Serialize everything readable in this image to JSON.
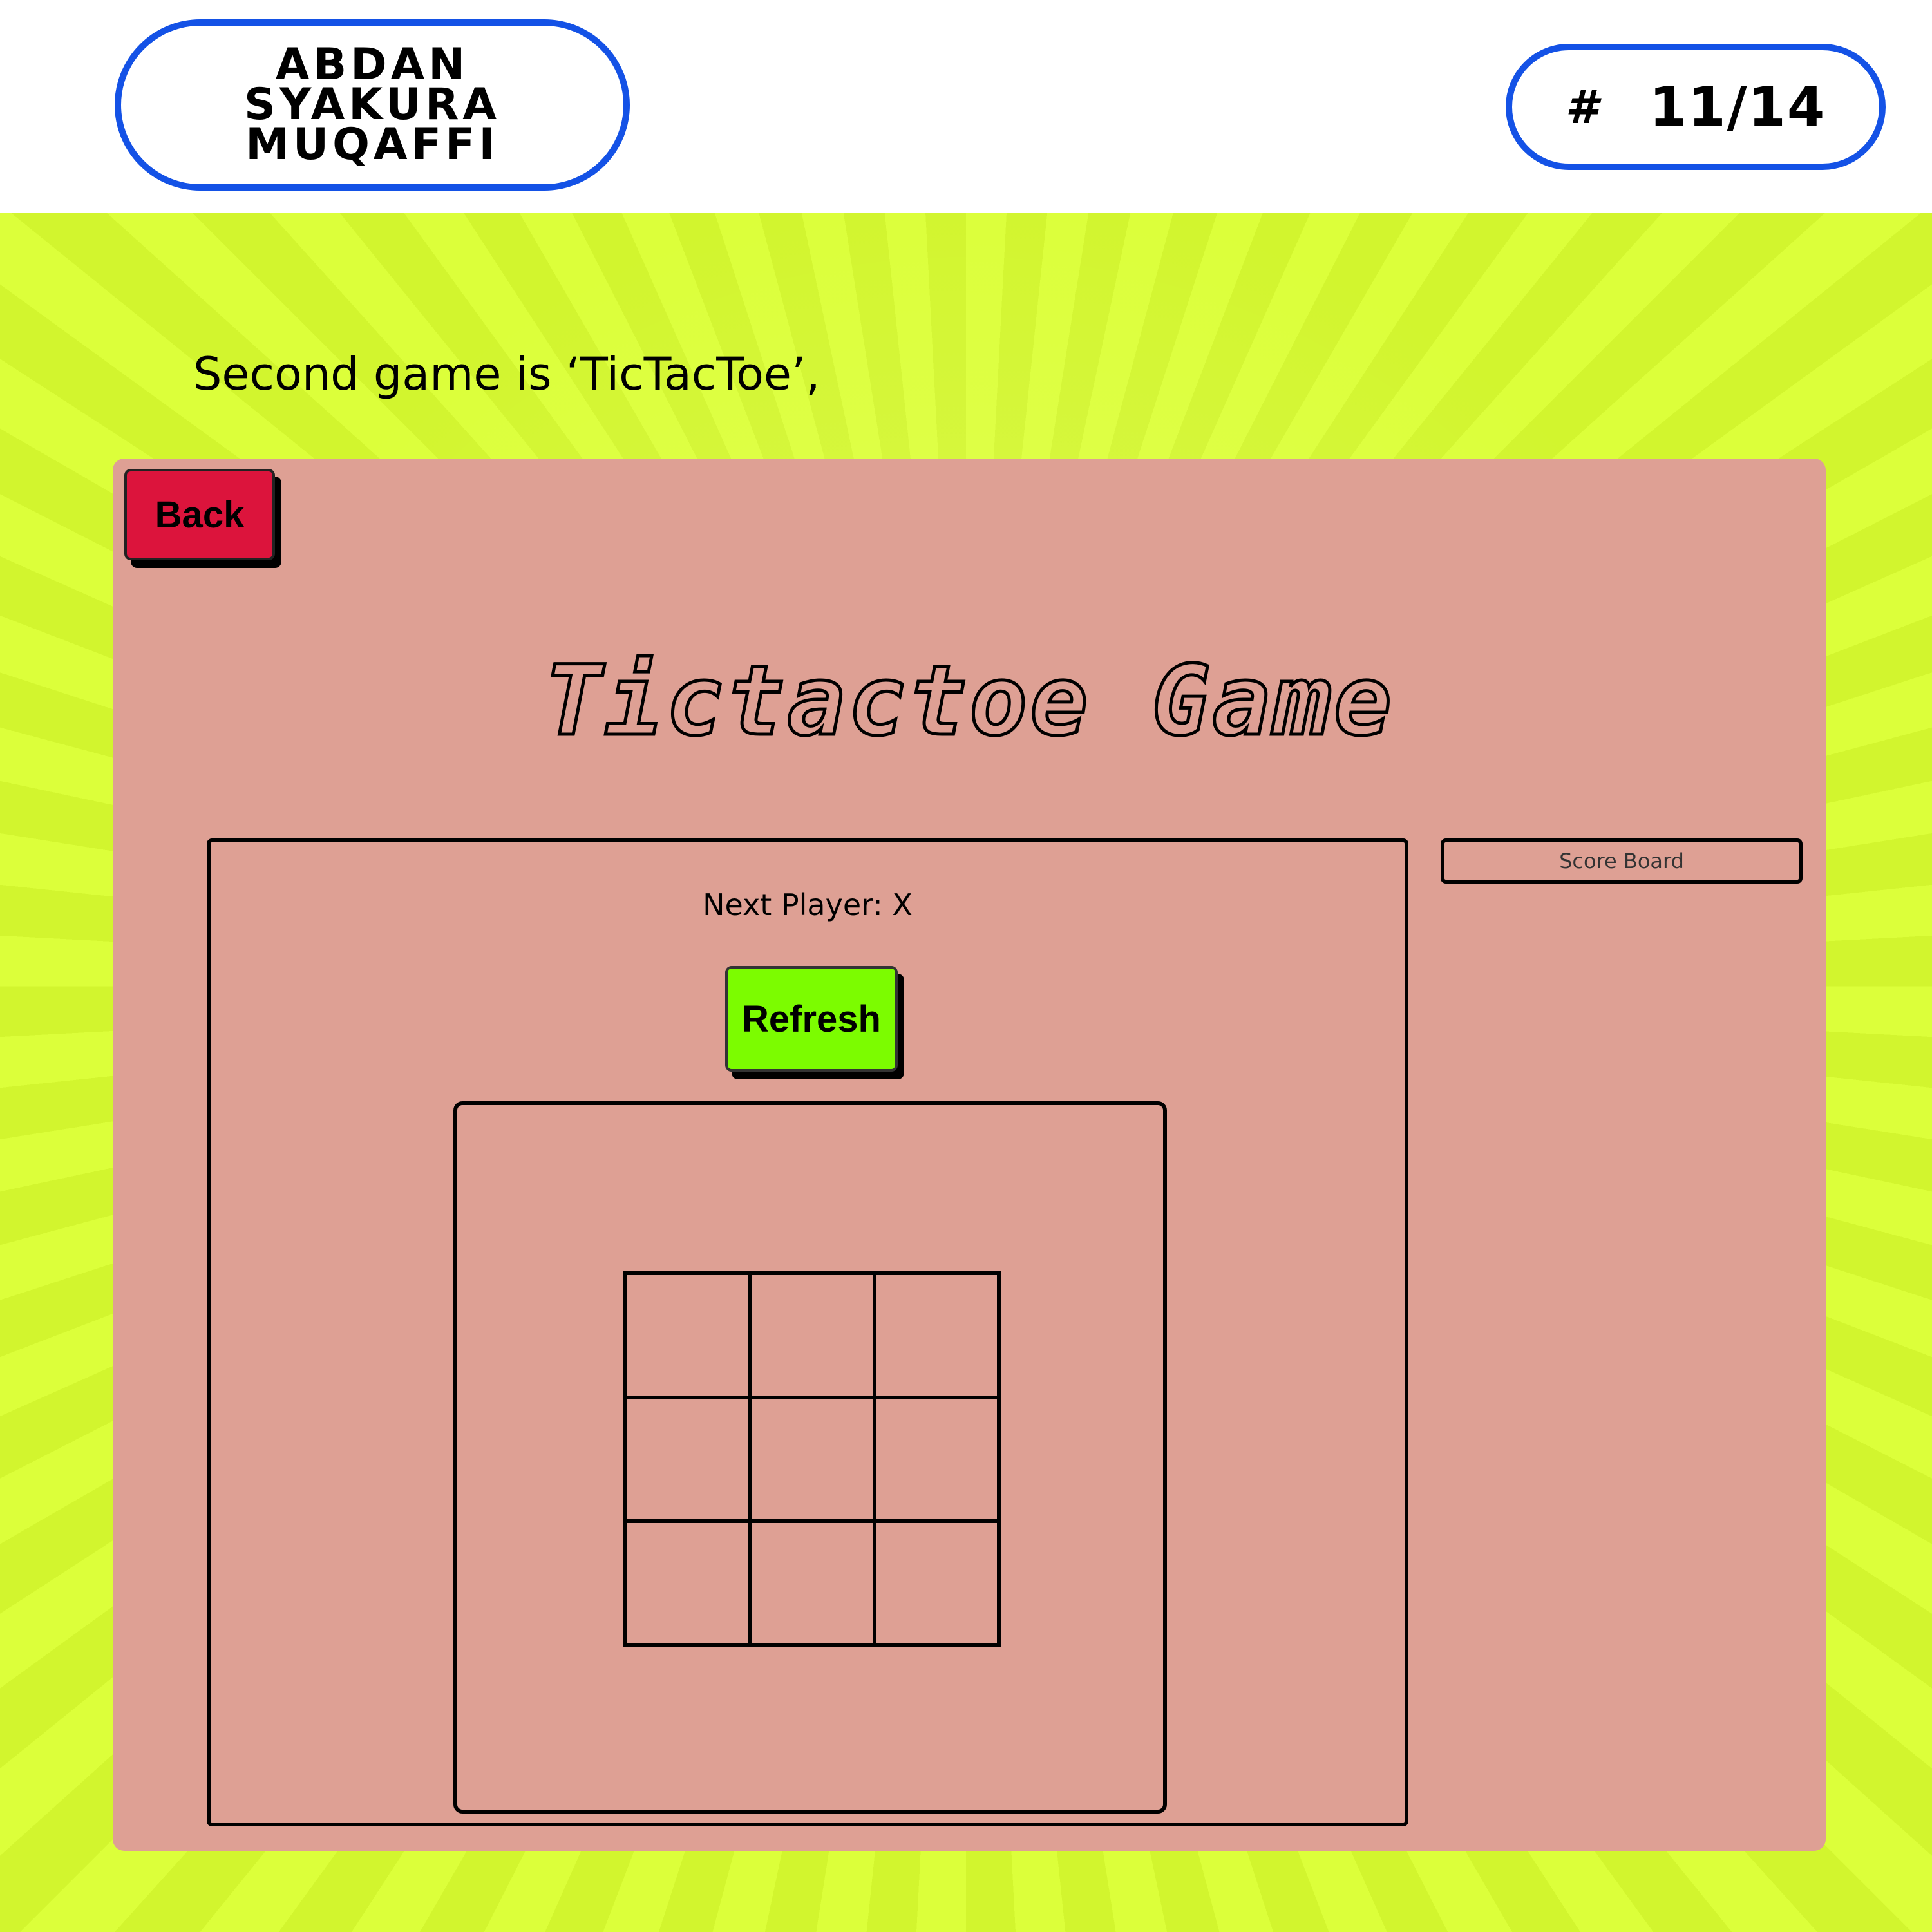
{
  "header": {
    "author_name": "ABDAN SYAKURA MUQAFFI",
    "page_hash": "#",
    "page_number": "11/14"
  },
  "intro_text": "Second game is ‘TicTacToe’,",
  "game": {
    "back_label": "Back",
    "title": "Tictactoe Game",
    "next_player_text": "Next Player: X",
    "refresh_label": "Refresh",
    "board": [
      "",
      "",
      "",
      "",
      "",
      "",
      "",
      "",
      ""
    ],
    "score_board_label": "Score Board"
  },
  "colors": {
    "background": "#d9fb36",
    "pill_border": "#1452e6",
    "panel": "#dea094",
    "back_button": "#dc143c",
    "refresh_button": "#7cfc00"
  }
}
